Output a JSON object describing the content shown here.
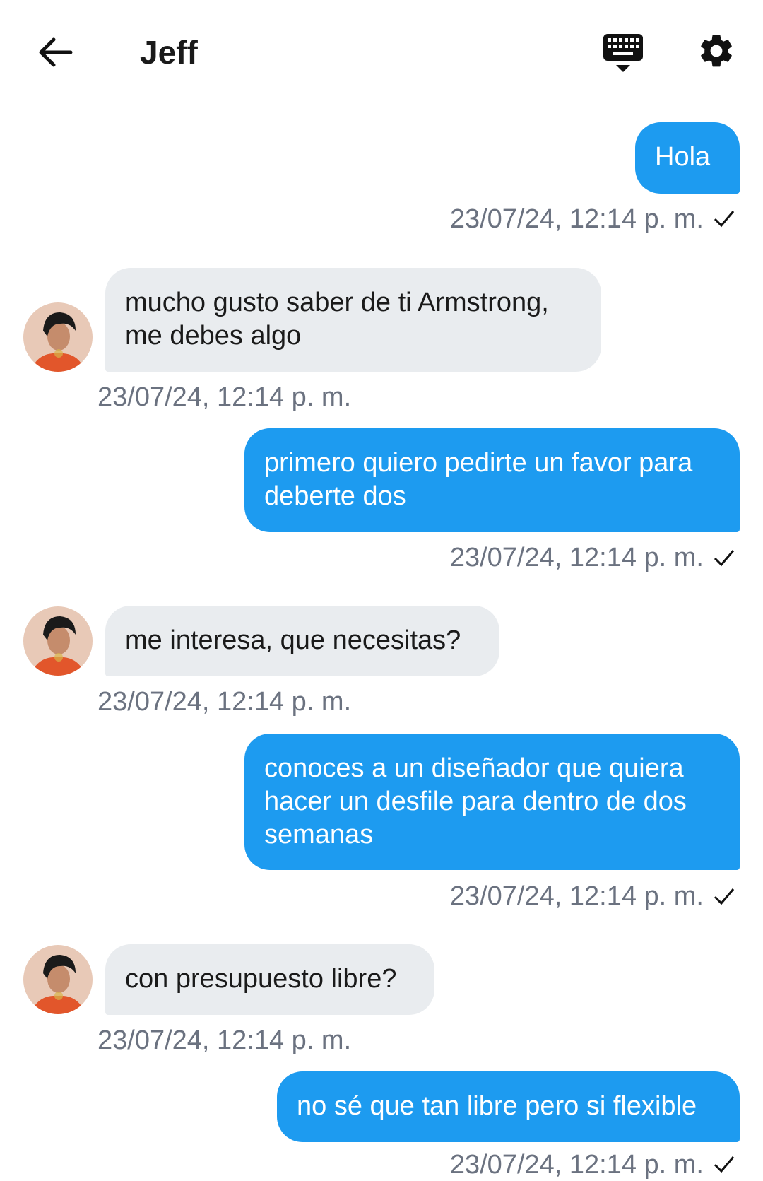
{
  "header": {
    "title": "Jeff",
    "back_icon": "arrow-left-icon",
    "keyboard_icon": "keyboard-hide-icon",
    "settings_icon": "gear-icon"
  },
  "colors": {
    "sent_bubble": "#1d9bf0",
    "received_bubble": "#e9ecef",
    "timestamp": "#6b7280"
  },
  "messages": [
    {
      "direction": "sent",
      "text": "Hola",
      "timestamp": "23/07/24, 12:14 p. m.",
      "status": "sent-check"
    },
    {
      "direction": "received",
      "text": "mucho gusto saber de ti Armstrong, me debes algo",
      "timestamp": "23/07/24, 12:14 p. m."
    },
    {
      "direction": "sent",
      "text": "primero quiero pedirte un favor para deberte dos",
      "timestamp": "23/07/24, 12:14 p. m.",
      "status": "sent-check"
    },
    {
      "direction": "received",
      "text": "me interesa, que necesitas?",
      "timestamp": "23/07/24, 12:14 p. m."
    },
    {
      "direction": "sent",
      "text": "conoces a un diseñador que quiera hacer un desfile para dentro de dos semanas",
      "timestamp": "23/07/24, 12:14 p. m.",
      "status": "sent-check"
    },
    {
      "direction": "received",
      "text": "con presupuesto libre?",
      "timestamp": "23/07/24, 12:14 p. m."
    },
    {
      "direction": "sent",
      "text": "no sé que tan libre pero si flexible",
      "timestamp": "23/07/24, 12:14 p. m.",
      "status": "sent-check"
    }
  ]
}
